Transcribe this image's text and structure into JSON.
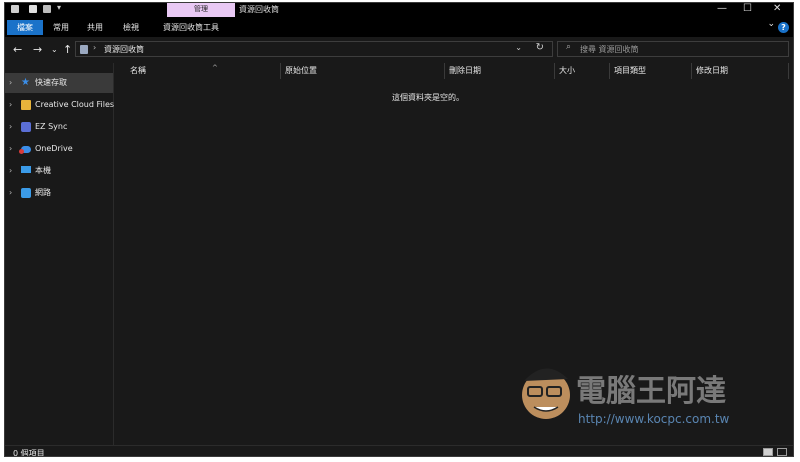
{
  "window": {
    "title": "資源回收筒",
    "context_tab": "管理",
    "controls": {
      "minimize": "—",
      "maximize": "☐",
      "close": "✕"
    }
  },
  "ribbon": {
    "tabs": [
      "檔案",
      "常用",
      "共用",
      "檢視",
      "資源回收筒工具"
    ],
    "collapse_glyph": "⌄",
    "help_glyph": "?"
  },
  "nav": {
    "back": "←",
    "forward": "→",
    "recent": "⌄",
    "up": "↑"
  },
  "address": {
    "separator": "›",
    "crumb": "資源回收筒",
    "dropdown": "⌄",
    "refresh": "↻"
  },
  "search": {
    "icon": "⌕",
    "placeholder": "搜尋 資源回收筒"
  },
  "sidebar": {
    "items": [
      {
        "label": "快速存取",
        "icon": "star-icon",
        "color": "#3b8ee8"
      },
      {
        "label": "Creative Cloud Files",
        "icon": "folder-icon",
        "color": "#e8b43b"
      },
      {
        "label": "EZ Sync",
        "icon": "sync-icon",
        "color": "#5b6fd6"
      },
      {
        "label": "OneDrive",
        "icon": "cloud-icon",
        "color": "#3b8ee8"
      },
      {
        "label": "本機",
        "icon": "computer-icon",
        "color": "#3b9be8"
      },
      {
        "label": "網路",
        "icon": "network-icon",
        "color": "#3b9be8"
      }
    ]
  },
  "columns": [
    "名稱",
    "原始位置",
    "刪除日期",
    "大小",
    "項目類型",
    "修改日期"
  ],
  "sort_indicator": "^",
  "empty_message": "這個資料夾是空的。",
  "status": {
    "item_count": "0 個項目"
  },
  "watermark": {
    "brand": "電腦王阿達",
    "url": "http://www.kocpc.com.tw"
  }
}
